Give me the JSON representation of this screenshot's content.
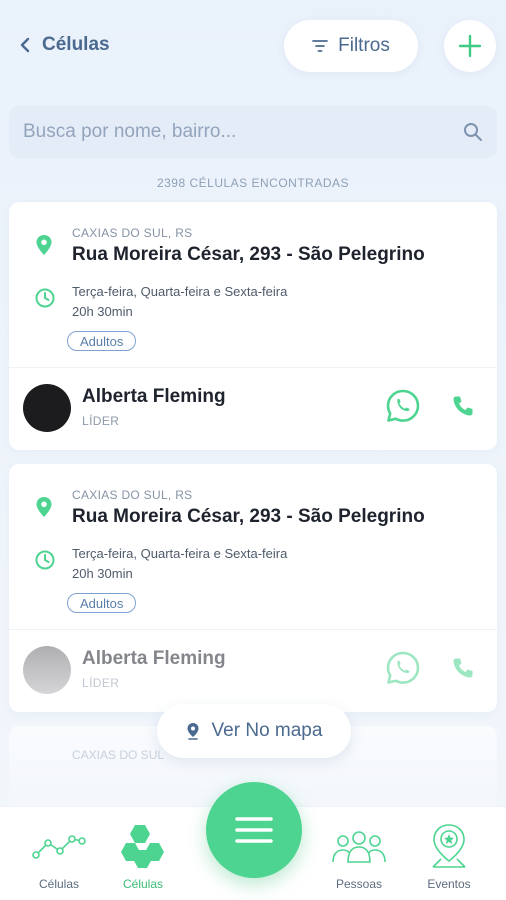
{
  "header": {
    "back_label": "Células",
    "filter_label": "Filtros"
  },
  "search": {
    "placeholder": "Busca por nome, bairro..."
  },
  "results": {
    "count_text": "2398 CÉLULAS ENCONTRADAS"
  },
  "cards": [
    {
      "city": "CAXIAS DO SUL, RS",
      "street": "Rua Moreira César, 293 - São Pelegrino",
      "days": "Terça-feira, Quarta-feira e Sexta-feira",
      "time": "20h 30min",
      "tag": "Adultos",
      "leader_name": "Alberta Fleming",
      "leader_role": "LÍDER"
    },
    {
      "city": "CAXIAS DO SUL, RS",
      "street": "Rua Moreira César, 293 - São Pelegrino",
      "days": "Terça-feira, Quarta-feira e Sexta-feira",
      "time": "20h 30min",
      "tag": "Adultos",
      "leader_name": "Alberta Fleming",
      "leader_role": "LÍDER"
    }
  ],
  "ghost_card": {
    "city": "CAXIAS DO SUL"
  },
  "map_button": {
    "label": "Ver No mapa"
  },
  "bottom_nav": {
    "items": [
      {
        "label": "Células",
        "icon": "graph-line-icon"
      },
      {
        "label": "Células",
        "icon": "hexagons-icon"
      },
      {
        "label": "Pessoas",
        "icon": "people-icon"
      },
      {
        "label": "Eventos",
        "icon": "map-pin-star-icon"
      }
    ],
    "active_index": 1
  },
  "colors": {
    "accent_green": "#4dd490",
    "label_blue": "#4b6a8f"
  }
}
